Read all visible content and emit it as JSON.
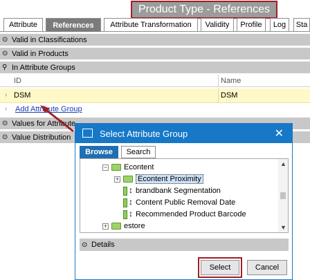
{
  "page_title": "Product Type - References",
  "tabs": [
    {
      "label": "Attribute",
      "underline": "A"
    },
    {
      "label": "References"
    },
    {
      "label": "Attribute Transformation"
    },
    {
      "label": "Validity"
    },
    {
      "label": "Profile"
    },
    {
      "label": "Log"
    },
    {
      "label": "Sta"
    }
  ],
  "sections": {
    "valid_classifications": "Valid in Classifications",
    "valid_products": "Valid in Products",
    "attribute_groups": "In Attribute Groups",
    "values_for_attribute": "Values for Attribute",
    "value_distribution": "Value Distribution"
  },
  "table": {
    "columns": [
      "ID",
      "Name"
    ],
    "rows": [
      {
        "id": "DSM",
        "name": "DSM"
      }
    ],
    "add_link": "Add Attribute Group"
  },
  "dialog": {
    "title": "Select Attribute Group",
    "tabs": [
      "Browse",
      "Search"
    ],
    "tree": [
      {
        "label": "Econtent"
      },
      {
        "label": "Econtent Proximity"
      },
      {
        "label": "brandbank Segmentation"
      },
      {
        "label": "Content Public Removal Date"
      },
      {
        "label": "Recommended Product Barcode"
      },
      {
        "label": "estore"
      }
    ],
    "details_label": "Details",
    "select_button": "Select",
    "cancel_button": "Cancel"
  },
  "colors": {
    "highlight": "#a31d26",
    "dialog_blue": "#1778c8",
    "row_selected": "#fff8c7"
  }
}
